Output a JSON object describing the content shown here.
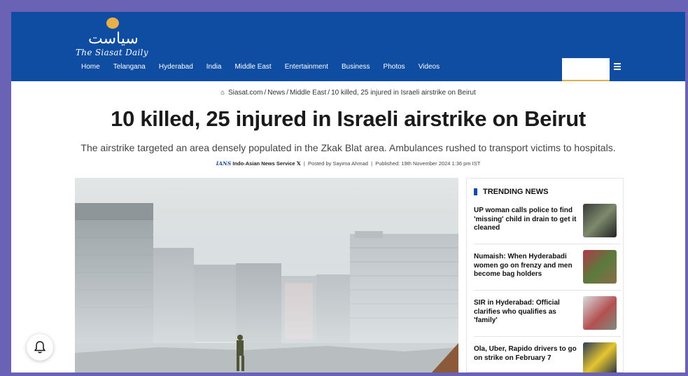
{
  "header": {
    "logo_urdu": "سیاست",
    "logo_english": "The Siasat Daily",
    "nav": [
      "Home",
      "Telangana",
      "Hyderabad",
      "India",
      "Middle East",
      "Entertainment",
      "Business",
      "Photos",
      "Videos"
    ]
  },
  "breadcrumb": {
    "home_icon": "home-icon",
    "items": [
      "Siasat.com",
      "News",
      "Middle East",
      "10 killed, 25 injured in Israeli airstrike on Beirut"
    ],
    "separator": "/"
  },
  "article": {
    "title": "10 killed, 25 injured in Israeli airstrike on Beirut",
    "subtitle": "The airstrike targeted an area densely populated in the Zkak Blat area. Ambulances rushed to transport victims to hospitals.",
    "meta": {
      "agency_logo": "IANS",
      "agency": "Indo-Asian News Service",
      "x_icon": "𝕏",
      "separator": "|",
      "posted_by": "Posted by Sayima Ahmad",
      "published": "Published: 19th November 2024 1:36 pm IST"
    }
  },
  "trending": {
    "heading": "TRENDING NEWS",
    "items": [
      {
        "title": "UP woman calls police to find 'missing' child in drain to get it cleaned"
      },
      {
        "title": "Numaish: When Hyderabadi women go on frenzy and men become bag holders"
      },
      {
        "title": "SIR in Hyderabad: Official clarifies who qualifies as 'family'"
      },
      {
        "title": "Ola, Uber, Rapido drivers to go on strike on February 7"
      }
    ]
  },
  "colors": {
    "brand_blue": "#0e4da1",
    "frame_purple": "#6a62b4",
    "accent_gold": "#e0b050"
  }
}
